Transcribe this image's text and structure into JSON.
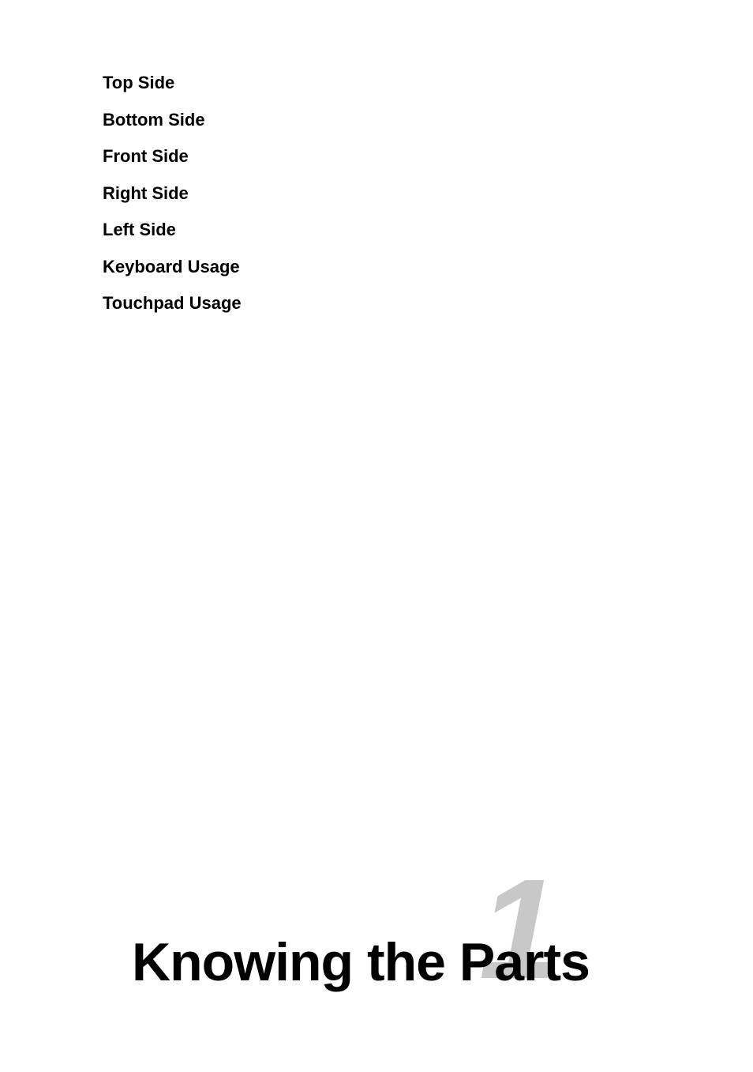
{
  "nav": {
    "items": [
      {
        "label": "Top Side"
      },
      {
        "label": "Bottom Side"
      },
      {
        "label": "Front Side"
      },
      {
        "label": "Right Side"
      },
      {
        "label": "Left Side"
      },
      {
        "label": "Keyboard Usage"
      },
      {
        "label": "Touchpad Usage"
      }
    ]
  },
  "chapter": {
    "title": "Knowing the Parts",
    "number": "1"
  }
}
